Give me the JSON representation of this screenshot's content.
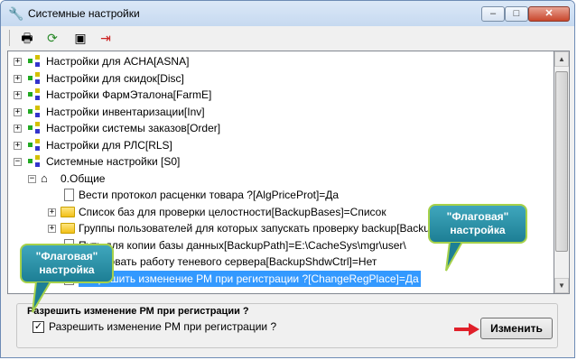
{
  "window": {
    "title": "Системные настройки",
    "title_icon": "wrench-icon"
  },
  "toolbar": {
    "buttons": [
      {
        "name": "print-icon",
        "glyph": "🖶"
      },
      {
        "name": "refresh-icon",
        "glyph": "⟳"
      },
      {
        "name": "export-icon",
        "glyph": "▣"
      },
      {
        "name": "exit-icon",
        "glyph": "⇥"
      }
    ]
  },
  "tree": {
    "groups": [
      "Настройки для АСНА[ASNA]",
      "Настройки для скидок[Disc]",
      "Настройки ФармЭталона[FarmE]",
      "Настройки инвентаризации[Inv]",
      "Настройки системы заказов[Order]",
      "Настройки для РЛС[RLS]",
      "Системные настройки [S0]"
    ],
    "subgroup": "0.Общие",
    "items": [
      "Вести протокол расценки товара ?[AlgPriceProt]=Да",
      "Список баз для проверки целостности[BackupBases]=Список",
      "Группы пользователей для которых запускать проверку backup[BackupGroups]=Список",
      "Путь для копии базы данных[BackupPath]=E:\\CacheSys\\mgr\\user\\",
      "Копировать работу теневого сервера[BackupShdwCtrl]=Нет",
      "Разрешить изменение РМ при регистрации ?[ChangeRegPlace]=Да"
    ]
  },
  "editor": {
    "group_title": "Разрешить изменение РМ при регистрации ?",
    "checkbox_label": "Разрешить изменение РМ при регистрации ?",
    "checkbox_checked": true,
    "checkbox_glyph": "✓",
    "button_label": "Изменить"
  },
  "callouts": {
    "right_line1": "\"Флаговая\"",
    "right_line2": "настройка",
    "left_line1": "\"Флаговая\"",
    "left_line2": "настройка"
  },
  "colors": {
    "selection": "#3399ff",
    "callout": "#2a92aa",
    "callout_border": "#a6d14a",
    "arrow": "#e0202a"
  }
}
